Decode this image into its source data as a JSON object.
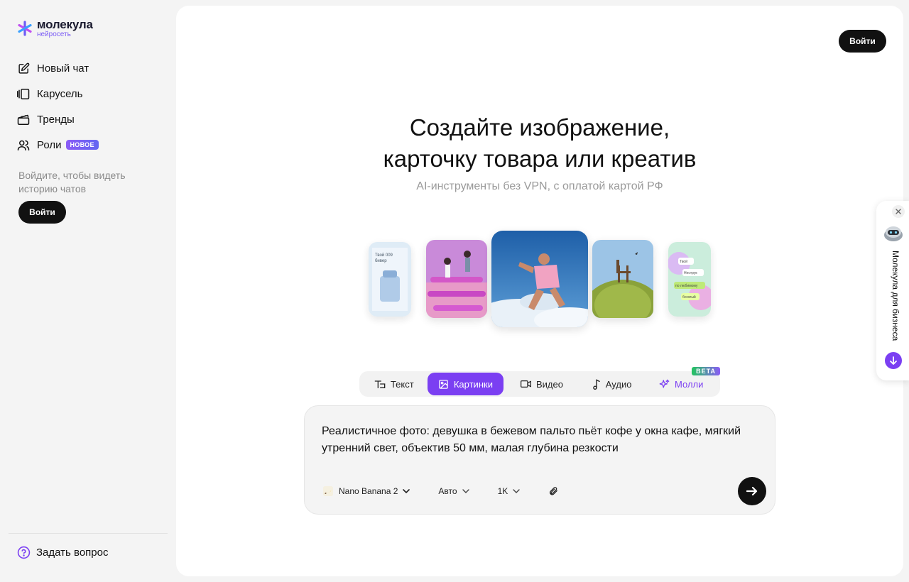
{
  "brand": {
    "name": "молекула",
    "subtitle": "нейросеть",
    "accent": "#7b3ff2"
  },
  "sidebar": {
    "items": [
      {
        "label": "Новый чат",
        "icon": "edit-icon"
      },
      {
        "label": "Карусель",
        "icon": "carousel-icon"
      },
      {
        "label": "Тренды",
        "icon": "clapperboard-icon"
      },
      {
        "label": "Роли",
        "icon": "users-icon",
        "badge": "НОВОЕ"
      }
    ],
    "hint": "Войдите, чтобы видеть историю чатов",
    "login_label": "Войти",
    "ask_label": "Задать вопрос"
  },
  "header": {
    "login_label": "Войти"
  },
  "hero": {
    "title_line1": "Создайте изображение,",
    "title_line2": "карточку товара или креатив",
    "subtitle": "AI-инструменты без VPN, с оплатой картой РФ"
  },
  "gallery": {
    "card1_line1": "Твой 009",
    "card1_line2": "бивер",
    "card5_labels": [
      "Твой",
      "Неструк",
      "по любимому",
      "богатый"
    ]
  },
  "tabs": [
    {
      "label": "Текст",
      "icon": "text-icon",
      "active": false
    },
    {
      "label": "Картинки",
      "icon": "image-icon",
      "active": true
    },
    {
      "label": "Видео",
      "icon": "video-icon",
      "active": false
    },
    {
      "label": "Аудио",
      "icon": "music-note-icon",
      "active": false
    },
    {
      "label": "Молли",
      "icon": "sparkles-icon",
      "active": false,
      "badge": "BETA"
    }
  ],
  "prompt": {
    "text": "Реалистичное фото: девушка в бежевом пальто пьёт кофе у окна кафе, мягкий утренний свет, объектив 50 мм, малая глубина резкости",
    "model": "Nano Banana 2",
    "aspect": "Авто",
    "resolution": "1K"
  },
  "business_widget": {
    "label": "Молекула для бизнеса"
  }
}
